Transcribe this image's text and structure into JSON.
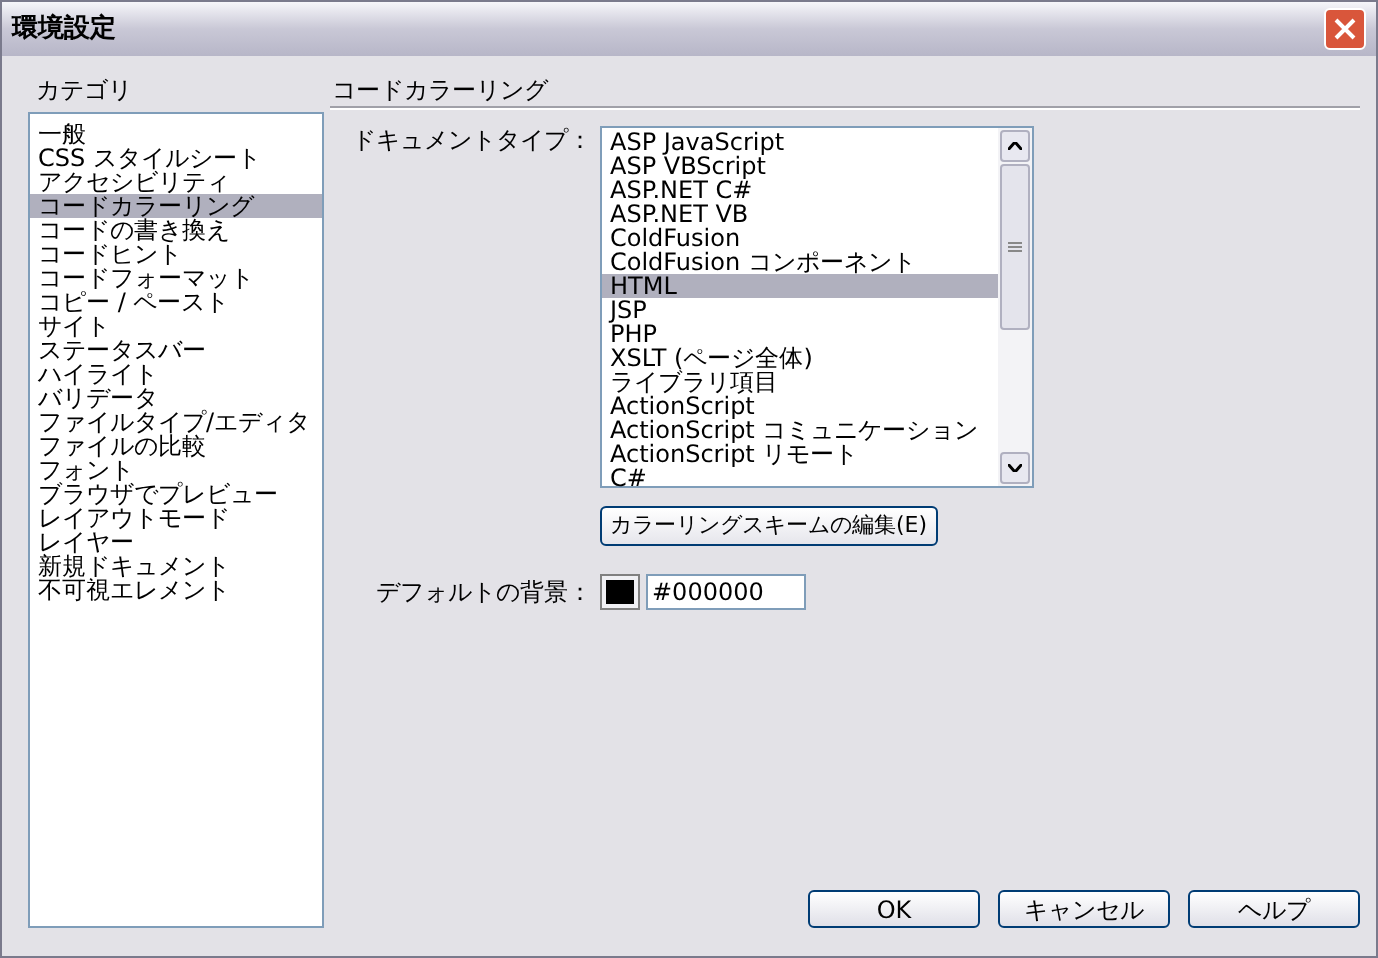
{
  "window": {
    "title": "環境設定"
  },
  "category": {
    "label": "カテゴリ",
    "items": [
      {
        "label": "一般",
        "selected": false
      },
      {
        "label": "CSS スタイルシート",
        "selected": false
      },
      {
        "label": "アクセシビリティ",
        "selected": false
      },
      {
        "label": "コードカラーリング",
        "selected": true
      },
      {
        "label": "コードの書き換え",
        "selected": false
      },
      {
        "label": "コードヒント",
        "selected": false
      },
      {
        "label": "コードフォーマット",
        "selected": false
      },
      {
        "label": "コピー / ペースト",
        "selected": false
      },
      {
        "label": "サイト",
        "selected": false
      },
      {
        "label": "ステータスバー",
        "selected": false
      },
      {
        "label": "ハイライト",
        "selected": false
      },
      {
        "label": "バリデータ",
        "selected": false
      },
      {
        "label": "ファイルタイプ/エディタ",
        "selected": false
      },
      {
        "label": "ファイルの比較",
        "selected": false
      },
      {
        "label": "フォント",
        "selected": false
      },
      {
        "label": "ブラウザでプレビュー",
        "selected": false
      },
      {
        "label": "レイアウトモード",
        "selected": false
      },
      {
        "label": "レイヤー",
        "selected": false
      },
      {
        "label": "新規ドキュメント",
        "selected": false
      },
      {
        "label": "不可視エレメント",
        "selected": false
      }
    ]
  },
  "panel": {
    "title": "コードカラーリング",
    "document_type": {
      "label": "ドキュメントタイプ：",
      "items": [
        {
          "label": "ASP JavaScript",
          "selected": false
        },
        {
          "label": "ASP VBScript",
          "selected": false
        },
        {
          "label": "ASP.NET C#",
          "selected": false
        },
        {
          "label": "ASP.NET VB",
          "selected": false
        },
        {
          "label": "ColdFusion",
          "selected": false
        },
        {
          "label": "ColdFusion コンポーネント",
          "selected": false
        },
        {
          "label": "HTML",
          "selected": true
        },
        {
          "label": "JSP",
          "selected": false
        },
        {
          "label": "PHP",
          "selected": false
        },
        {
          "label": "XSLT (ページ全体)",
          "selected": false
        },
        {
          "label": "ライブラリ項目",
          "selected": false
        },
        {
          "label": "ActionScript",
          "selected": false
        },
        {
          "label": "ActionScript コミュニケーション",
          "selected": false
        },
        {
          "label": "ActionScript リモート",
          "selected": false
        },
        {
          "label": "C#",
          "selected": false
        }
      ]
    },
    "edit_scheme_button": "カラーリングスキームの編集(E)",
    "default_background": {
      "label": "デフォルトの背景：",
      "color": "#000000",
      "value": "#000000"
    }
  },
  "buttons": [
    "OK",
    "キャンセル",
    "ヘルプ"
  ]
}
